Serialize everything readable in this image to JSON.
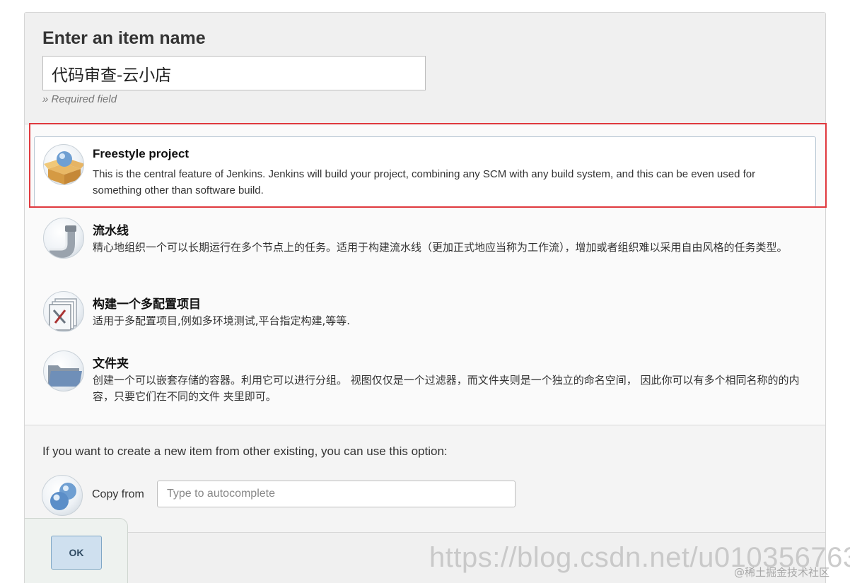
{
  "header": {
    "title": "Enter an item name",
    "item_name": "代码审查-云小店",
    "required_note": "» Required field"
  },
  "item_types": [
    {
      "icon": "freestyle-project-icon",
      "name": "Freestyle project",
      "description": "This is the central feature of Jenkins. Jenkins will build your project, combining any SCM with any build system, and this can be even used for something other than software build.",
      "selected": true
    },
    {
      "icon": "pipeline-icon",
      "name": "流水线",
      "description": "精心地组织一个可以长期运行在多个节点上的任务。适用于构建流水线（更加正式地应当称为工作流），增加或者组织难以采用自由风格的任务类型。",
      "selected": false
    },
    {
      "icon": "multi-config-project-icon",
      "name": "构建一个多配置项目",
      "description": "适用于多配置项目,例如多环境测试,平台指定构建,等等.",
      "selected": false
    },
    {
      "icon": "folder-icon",
      "name": "文件夹",
      "description": "创建一个可以嵌套存储的容器。利用它可以进行分组。 视图仅仅是一个过滤器，而文件夹则是一个独立的命名空间， 因此你可以有多个相同名称的的内容，只要它们在不同的文件 夹里即可。",
      "selected": false
    }
  ],
  "copy": {
    "hint": "If you want to create a new item from other existing, you can use this option:",
    "label": "Copy from",
    "placeholder": "Type to autocomplete",
    "icon": "copy-from-icon"
  },
  "ok_label": "OK",
  "watermark": {
    "url": "https://blog.csdn.net/u010356763",
    "site": "@稀土掘金技术社区"
  },
  "colors": {
    "highlight": "#e0393e",
    "ok_bg": "#cfe0ef",
    "ok_border": "#7fa7c6"
  }
}
